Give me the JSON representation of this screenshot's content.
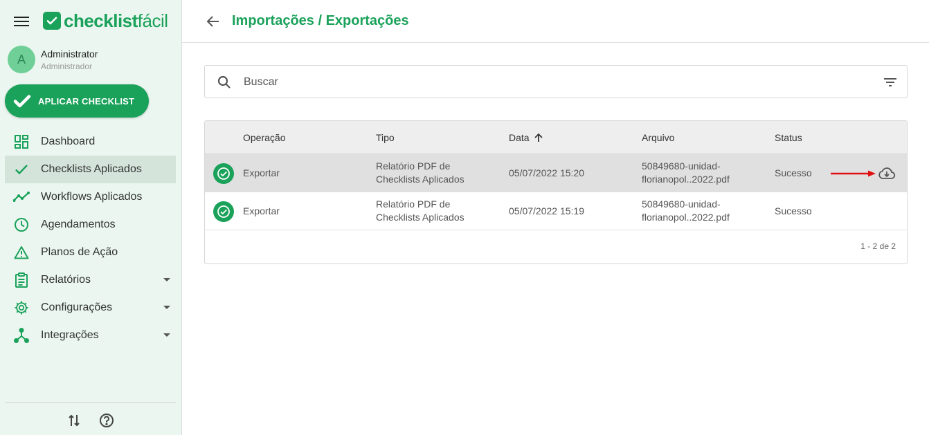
{
  "brand": {
    "logo_bold": "checklist",
    "logo_light": "fácil",
    "color": "#1aa15a"
  },
  "user": {
    "initial": "A",
    "name": "Administrator",
    "role": "Administrador"
  },
  "apply_button": {
    "label": "APLICAR CHECKLIST"
  },
  "nav": [
    {
      "label": "Dashboard",
      "icon": "dashboard-icon",
      "active": false
    },
    {
      "label": "Checklists Aplicados",
      "icon": "check-icon",
      "active": true
    },
    {
      "label": "Workflows Aplicados",
      "icon": "trend-icon",
      "active": false
    },
    {
      "label": "Agendamentos",
      "icon": "clock-icon",
      "active": false
    },
    {
      "label": "Planos de Ação",
      "icon": "warning-icon",
      "active": false
    },
    {
      "label": "Relatórios",
      "icon": "report-icon",
      "active": false,
      "expandable": true
    },
    {
      "label": "Configurações",
      "icon": "gear-icon",
      "active": false,
      "expandable": true
    },
    {
      "label": "Integrações",
      "icon": "integration-icon",
      "active": false,
      "expandable": true
    }
  ],
  "header": {
    "title": "Importações / Exportações"
  },
  "search": {
    "placeholder": "Buscar",
    "value": ""
  },
  "table": {
    "columns": [
      "Operação",
      "Tipo",
      "Data",
      "Arquivo",
      "Status"
    ],
    "sorted_column": "Data",
    "rows": [
      {
        "operacao": "Exportar",
        "tipo_1": "Relatório PDF de",
        "tipo_2": "Checklists Aplicados",
        "data": "05/07/2022 15:20",
        "arquivo_1": "50849680-unidad-",
        "arquivo_2": "florianopol..2022.pdf",
        "status": "Sucesso",
        "highlighted": true
      },
      {
        "operacao": "Exportar",
        "tipo_1": "Relatório PDF de",
        "tipo_2": "Checklists Aplicados",
        "data": "05/07/2022 15:19",
        "arquivo_1": "50849680-unidad-",
        "arquivo_2": "florianopol..2022.pdf",
        "status": "Sucesso",
        "highlighted": false
      }
    ],
    "pagination": "1 - 2 de 2"
  },
  "annotation_color": "#e01010"
}
